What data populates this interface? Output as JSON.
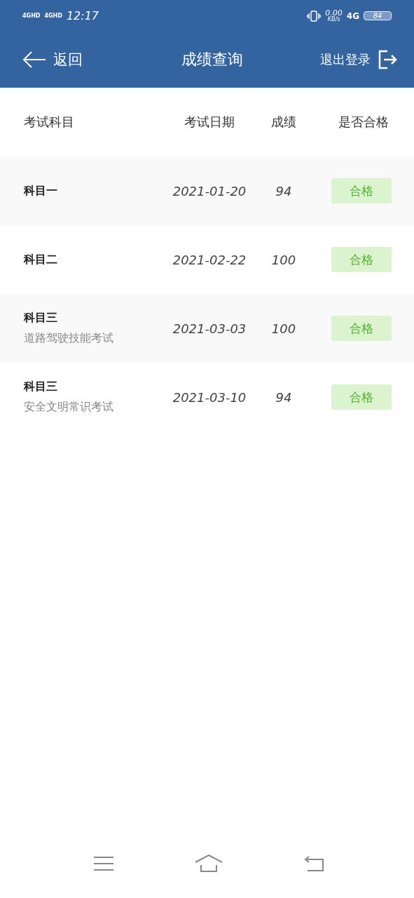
{
  "status_bar": {
    "sim_labels": [
      "4GHD",
      "4GHD"
    ],
    "time": "12:17",
    "speed": "0.00",
    "speed_unit": "KB/s",
    "network": "4G",
    "battery": "84"
  },
  "nav": {
    "back": "返回",
    "title": "成绩查询",
    "logout": "退出登录"
  },
  "table": {
    "columns": [
      "考试科目",
      "考试日期",
      "成绩",
      "是否合格"
    ],
    "rows": [
      {
        "subject": "科目一",
        "date": "2021-01-20",
        "score": "94",
        "result": {
          "text": "合格",
          "passed": true
        }
      },
      {
        "subject": "科目二",
        "date": "2021-02-22",
        "score": "100",
        "result": {
          "text": "合格",
          "passed": true
        }
      },
      {
        "subject": "科目三",
        "detail": "道路驾驶技能考试",
        "date": "2021-03-03",
        "score": "100",
        "result": {
          "text": "合格",
          "passed": true
        }
      },
      {
        "subject": "科目三",
        "detail": "安全文明常识考试",
        "date": "2021-03-10",
        "score": "94",
        "result": {
          "text": "合格",
          "passed": true
        }
      }
    ]
  }
}
